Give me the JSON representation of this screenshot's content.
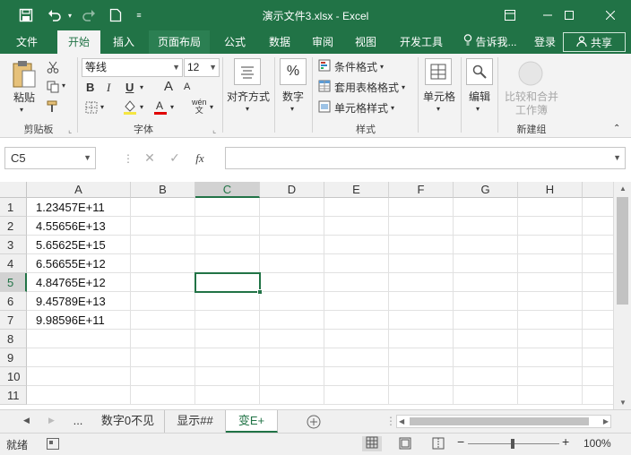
{
  "titlebar": {
    "title": "演示文件3.xlsx - Excel",
    "save_icon": "save-icon",
    "undo_icon": "undo-icon",
    "redo_icon": "redo-icon",
    "new_icon": "new-document-icon",
    "customize_icon": "customize-qat-icon"
  },
  "tabs": [
    "文件",
    "开始",
    "插入",
    "页面布局",
    "公式",
    "数据",
    "审阅",
    "视图",
    "开发工具"
  ],
  "tellme": "告诉我...",
  "signin": "登录",
  "share": "共享",
  "ribbon": {
    "clipboard": {
      "paste": "粘贴",
      "label": "剪贴板"
    },
    "font": {
      "name": "等线",
      "size": "12",
      "bold": "B",
      "italic": "I",
      "underline": "U",
      "grow": "A",
      "shrink": "A",
      "label": "字体",
      "phonetic": "wén"
    },
    "alignment": {
      "label": "对齐方式"
    },
    "number": {
      "label": "数字",
      "symbol": "%"
    },
    "styles": {
      "conditional": "条件格式",
      "table": "套用表格格式",
      "cell": "单元格样式",
      "label": "样式"
    },
    "cells": {
      "label": "单元格"
    },
    "editing": {
      "label": "编辑"
    },
    "newgroup": {
      "compare": "比较和合并",
      "workbook": "工作簿",
      "label": "新建组"
    }
  },
  "formula_bar": {
    "namebox": "C5",
    "fx": "fx",
    "value": ""
  },
  "columns": [
    "A",
    "B",
    "C",
    "D",
    "E",
    "F",
    "G",
    "H"
  ],
  "rows": [
    "1",
    "2",
    "3",
    "4",
    "5",
    "6",
    "7",
    "8",
    "9",
    "10",
    "11"
  ],
  "cells_a": [
    "1.23457E+11",
    "4.55656E+13",
    "5.65625E+15",
    "6.56655E+12",
    "4.84765E+12",
    "9.45789E+13",
    "9.98596E+11",
    "",
    "",
    "",
    ""
  ],
  "selected_cell": "C5",
  "sheets": {
    "more": "...",
    "tabs": [
      "数字0不见",
      "显示##",
      "变E+"
    ],
    "active": 2
  },
  "status": {
    "ready": "就绪",
    "zoom": "100%"
  },
  "colors": {
    "accent": "#217346"
  }
}
